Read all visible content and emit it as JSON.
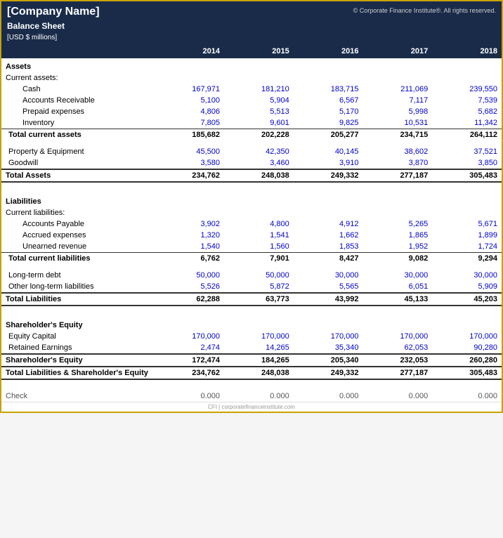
{
  "header": {
    "company_name": "[Company Name]",
    "balance_sheet": "Balance Sheet",
    "currency": "[USD $ millions]",
    "copyright": "© Corporate Finance Institute®. All rights reserved."
  },
  "years": [
    "2014",
    "2015",
    "2016",
    "2017",
    "2018"
  ],
  "sections": {
    "assets": {
      "label": "Assets",
      "current_assets_label": "Current assets:",
      "current_items": [
        {
          "label": "Cash",
          "values": [
            "167,971",
            "181,210",
            "183,715",
            "211,069",
            "239,550"
          ],
          "blue": true
        },
        {
          "label": "Accounts Receivable",
          "values": [
            "5,100",
            "5,904",
            "6,567",
            "7,117",
            "7,539"
          ],
          "blue": true
        },
        {
          "label": "Prepaid expenses",
          "values": [
            "4,806",
            "5,513",
            "5,170",
            "5,998",
            "5,682"
          ],
          "blue": true
        },
        {
          "label": "Inventory",
          "values": [
            "7,805",
            "9,601",
            "9,825",
            "10,531",
            "11,342"
          ],
          "blue": true
        }
      ],
      "total_current": {
        "label": "Total current assets",
        "values": [
          "185,682",
          "202,228",
          "205,277",
          "234,715",
          "264,112"
        ]
      },
      "non_current_items": [
        {
          "label": "Property & Equipment",
          "values": [
            "45,500",
            "42,350",
            "40,145",
            "38,602",
            "37,521"
          ],
          "blue": true
        },
        {
          "label": "Goodwill",
          "values": [
            "3,580",
            "3,460",
            "3,910",
            "3,870",
            "3,850"
          ],
          "blue": true
        }
      ],
      "total_assets": {
        "label": "Total Assets",
        "values": [
          "234,762",
          "248,038",
          "249,332",
          "277,187",
          "305,483"
        ]
      }
    },
    "liabilities": {
      "label": "Liabilities",
      "current_label": "Current liabilities:",
      "current_items": [
        {
          "label": "Accounts Payable",
          "values": [
            "3,902",
            "4,800",
            "4,912",
            "5,265",
            "5,671"
          ],
          "blue": true
        },
        {
          "label": "Accrued expenses",
          "values": [
            "1,320",
            "1,541",
            "1,662",
            "1,865",
            "1,899"
          ],
          "blue": true
        },
        {
          "label": "Unearned revenue",
          "values": [
            "1,540",
            "1,560",
            "1,853",
            "1,952",
            "1,724"
          ],
          "blue": true
        }
      ],
      "total_current": {
        "label": "Total current liabilities",
        "values": [
          "6,762",
          "7,901",
          "8,427",
          "9,082",
          "9,294"
        ]
      },
      "non_current_items": [
        {
          "label": "Long-term debt",
          "values": [
            "50,000",
            "50,000",
            "30,000",
            "30,000",
            "30,000"
          ],
          "blue": true
        },
        {
          "label": "Other long-term liabilities",
          "values": [
            "5,526",
            "5,872",
            "5,565",
            "6,051",
            "5,909"
          ],
          "blue": true
        }
      ],
      "total_liabilities": {
        "label": "Total Liabilities",
        "values": [
          "62,288",
          "63,773",
          "43,992",
          "45,133",
          "45,203"
        ]
      }
    },
    "equity": {
      "label": "Shareholder's Equity",
      "items": [
        {
          "label": "Equity Capital",
          "values": [
            "170,000",
            "170,000",
            "170,000",
            "170,000",
            "170,000"
          ],
          "blue": true
        },
        {
          "label": "Retained Earnings",
          "values": [
            "2,474",
            "14,265",
            "35,340",
            "62,053",
            "90,280"
          ],
          "blue": true
        }
      ],
      "total_equity": {
        "label": "Shareholder's Equity",
        "values": [
          "172,474",
          "184,265",
          "205,340",
          "232,053",
          "260,280"
        ]
      },
      "total_liabilities_equity": {
        "label": "Total Liabilities & Shareholder's Equity",
        "values": [
          "234,762",
          "248,038",
          "249,332",
          "277,187",
          "305,483"
        ]
      }
    },
    "check": {
      "label": "Check",
      "values": [
        "0.000",
        "0.000",
        "0.000",
        "0.000",
        "0.000"
      ]
    }
  }
}
